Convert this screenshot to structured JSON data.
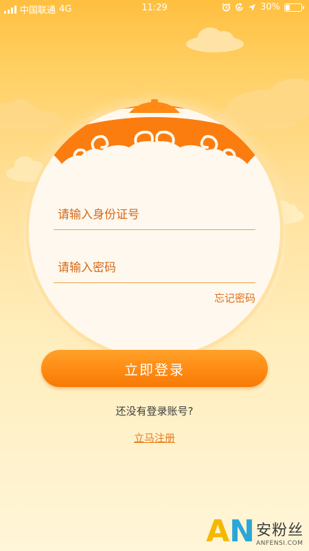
{
  "status_bar": {
    "carrier": "中国联通",
    "network": "4G",
    "time": "11:29",
    "battery": "30%",
    "battery_level": 0.3,
    "icons": [
      "signal-icon",
      "alarm-icon",
      "rotation-lock-icon",
      "location-icon",
      "battery-icon"
    ]
  },
  "login_form": {
    "id_placeholder": "请输入身份证号",
    "password_placeholder": "请输入密码",
    "forgot_password": "忘记密码",
    "login_button": "立即登录",
    "no_account_prompt": "还没有登录账号?",
    "register_link": "立马注册"
  },
  "watermark": {
    "letters_a": "A",
    "letters_n": "N",
    "chinese": "安粉丝",
    "domain": "ANFENSI.COM"
  },
  "colors": {
    "accent": "#ff8a12",
    "text_orange": "#d4691a",
    "background_top": "#ffbf3f",
    "background_bottom": "#fff5d8"
  }
}
